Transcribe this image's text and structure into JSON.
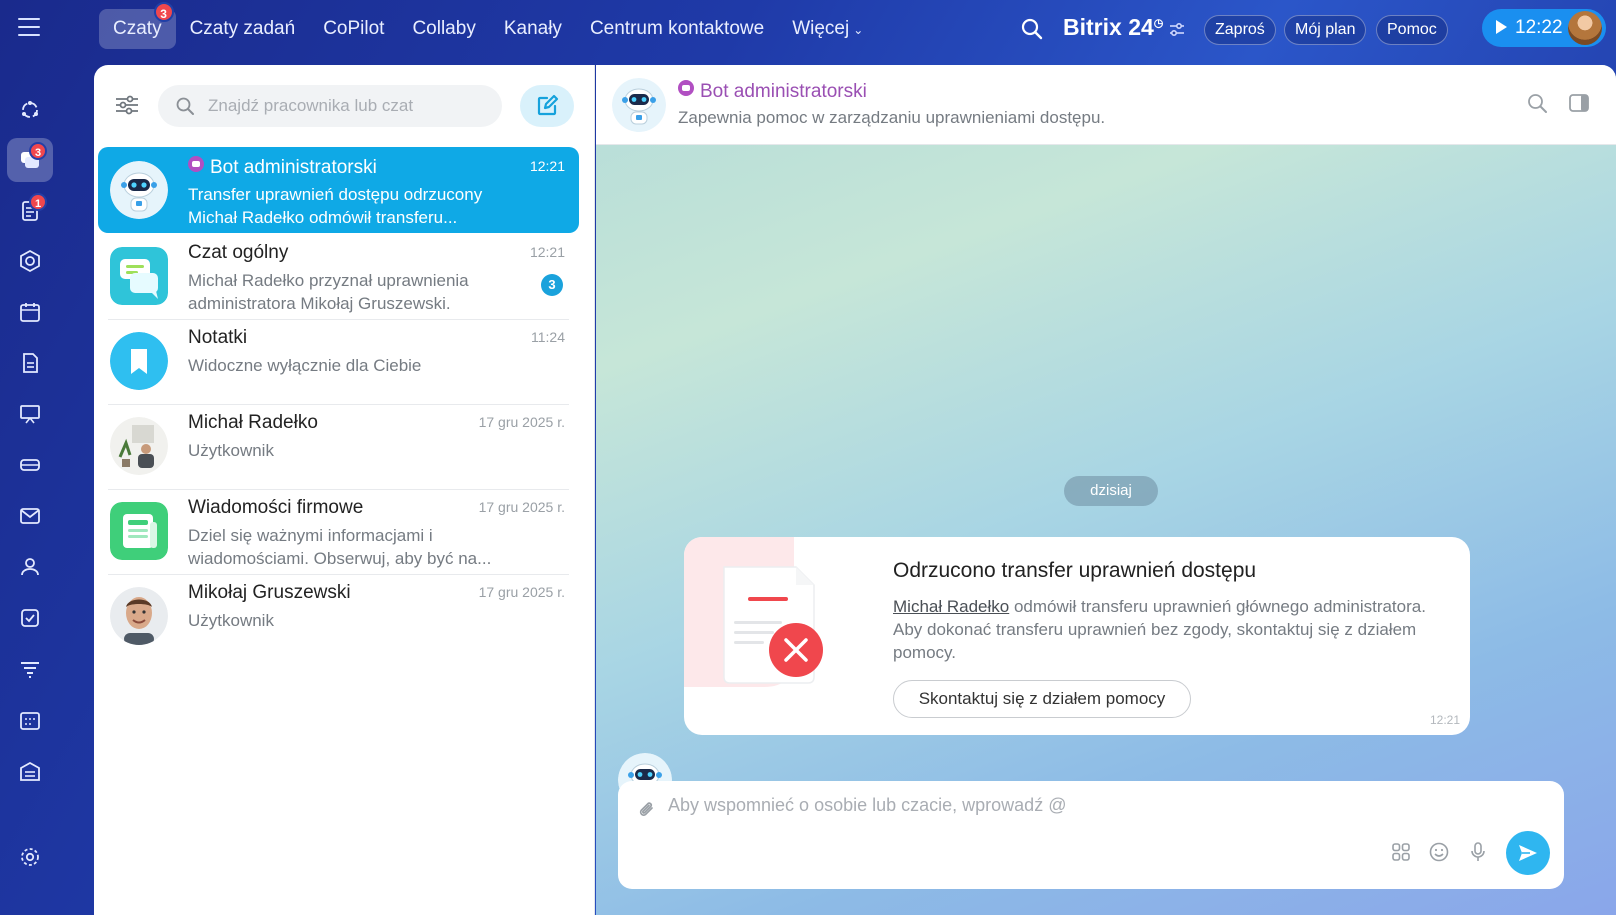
{
  "topbar": {
    "nav": [
      {
        "label": "Czaty",
        "badge": "3"
      },
      {
        "label": "Czaty zadań"
      },
      {
        "label": "CoPilot"
      },
      {
        "label": "Collaby"
      },
      {
        "label": "Kanały"
      },
      {
        "label": "Centrum kontaktowe"
      },
      {
        "label": "Więcej"
      }
    ],
    "brand": "Bitrix",
    "brand_num": "24",
    "invite": "Zaproś",
    "plan": "Mój plan",
    "help": "Pomoc",
    "time": "12:22"
  },
  "rail": {
    "chat_badge": "3",
    "feed_badge": "1"
  },
  "list": {
    "search_placeholder": "Znajdź pracownika lub czat",
    "chats": [
      {
        "title": "Bot administratorski",
        "time": "12:21",
        "line1": "Transfer uprawnień dostępu odrzucony",
        "line2": "Michał Radełko odmówił transferu..."
      },
      {
        "title": "Czat ogólny",
        "time": "12:21",
        "line1": "Michał Radełko przyznał uprawnienia",
        "line2": "administratora Mikołaj Gruszewski.",
        "unread": "3"
      },
      {
        "title": "Notatki",
        "time": "11:24",
        "line1": "Widoczne wyłącznie dla Ciebie",
        "line2": ""
      },
      {
        "title": "Michał Radełko",
        "time": "17 gru 2025 r.",
        "line1": "Użytkownik",
        "line2": ""
      },
      {
        "title": "Wiadomości firmowe",
        "time": "17 gru 2025 r.",
        "line1": "Dziel się ważnymi informacjami i",
        "line2": "wiadomościami. Obserwuj, aby być na..."
      },
      {
        "title": "Mikołaj Gruszewski",
        "time": "17 gru 2025 r.",
        "line1": "Użytkownik",
        "line2": ""
      }
    ]
  },
  "chat": {
    "title": "Bot administratorski",
    "subtitle": "Zapewnia pomoc w zarządzaniu uprawnieniami dostępu.",
    "date_chip": "dzisiaj",
    "card": {
      "title": "Odrzucono transfer uprawnień dostępu",
      "link": "Michał Radełko",
      "body1": " odmówił transferu uprawnień głównego administratora.",
      "body2": "Aby dokonać transferu uprawnień bez zgody, skontaktuj się z działem pomocy.",
      "button": "Skontaktuj się z działem pomocy",
      "time": "12:21"
    },
    "composer_placeholder": "Aby wspomnieć o osobie lub czacie, wprowadź @"
  },
  "colors": {
    "accent": "#0fa9e6",
    "badge": "#f0474d",
    "bot_title": "#9a4fb3"
  }
}
